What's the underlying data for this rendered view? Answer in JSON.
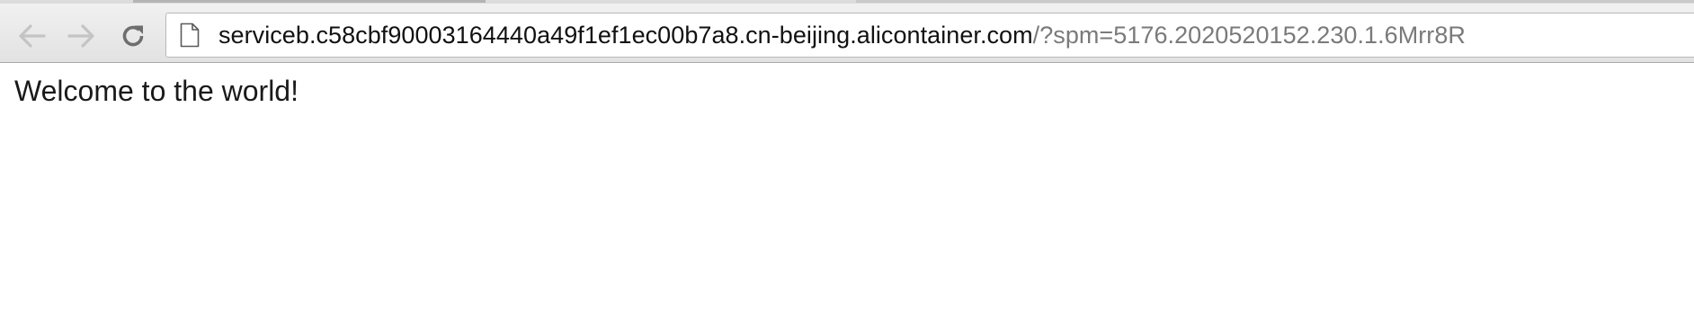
{
  "toolbar": {
    "back_icon": "arrow-left-icon",
    "forward_icon": "arrow-right-icon",
    "reload_icon": "reload-icon",
    "back_enabled": false,
    "forward_enabled": false
  },
  "omnibox": {
    "page_icon": "page-icon",
    "url_host": "serviceb.c58cbf90003164440a49f1ef1ec00b7a8.cn-beijing.alicontainer.com",
    "url_rest": "/?spm=5176.2020520152.230.1.6Mrr8R"
  },
  "page": {
    "body_text": "Welcome to the world!"
  },
  "colors": {
    "toolbar_top": "#f1f1f1",
    "toolbar_bottom": "#e2e2e2",
    "disabled_icon": "#c4c4c4",
    "reload_icon": "#6e6e6e",
    "url_host": "#111111",
    "url_rest": "#7a7a7a"
  }
}
